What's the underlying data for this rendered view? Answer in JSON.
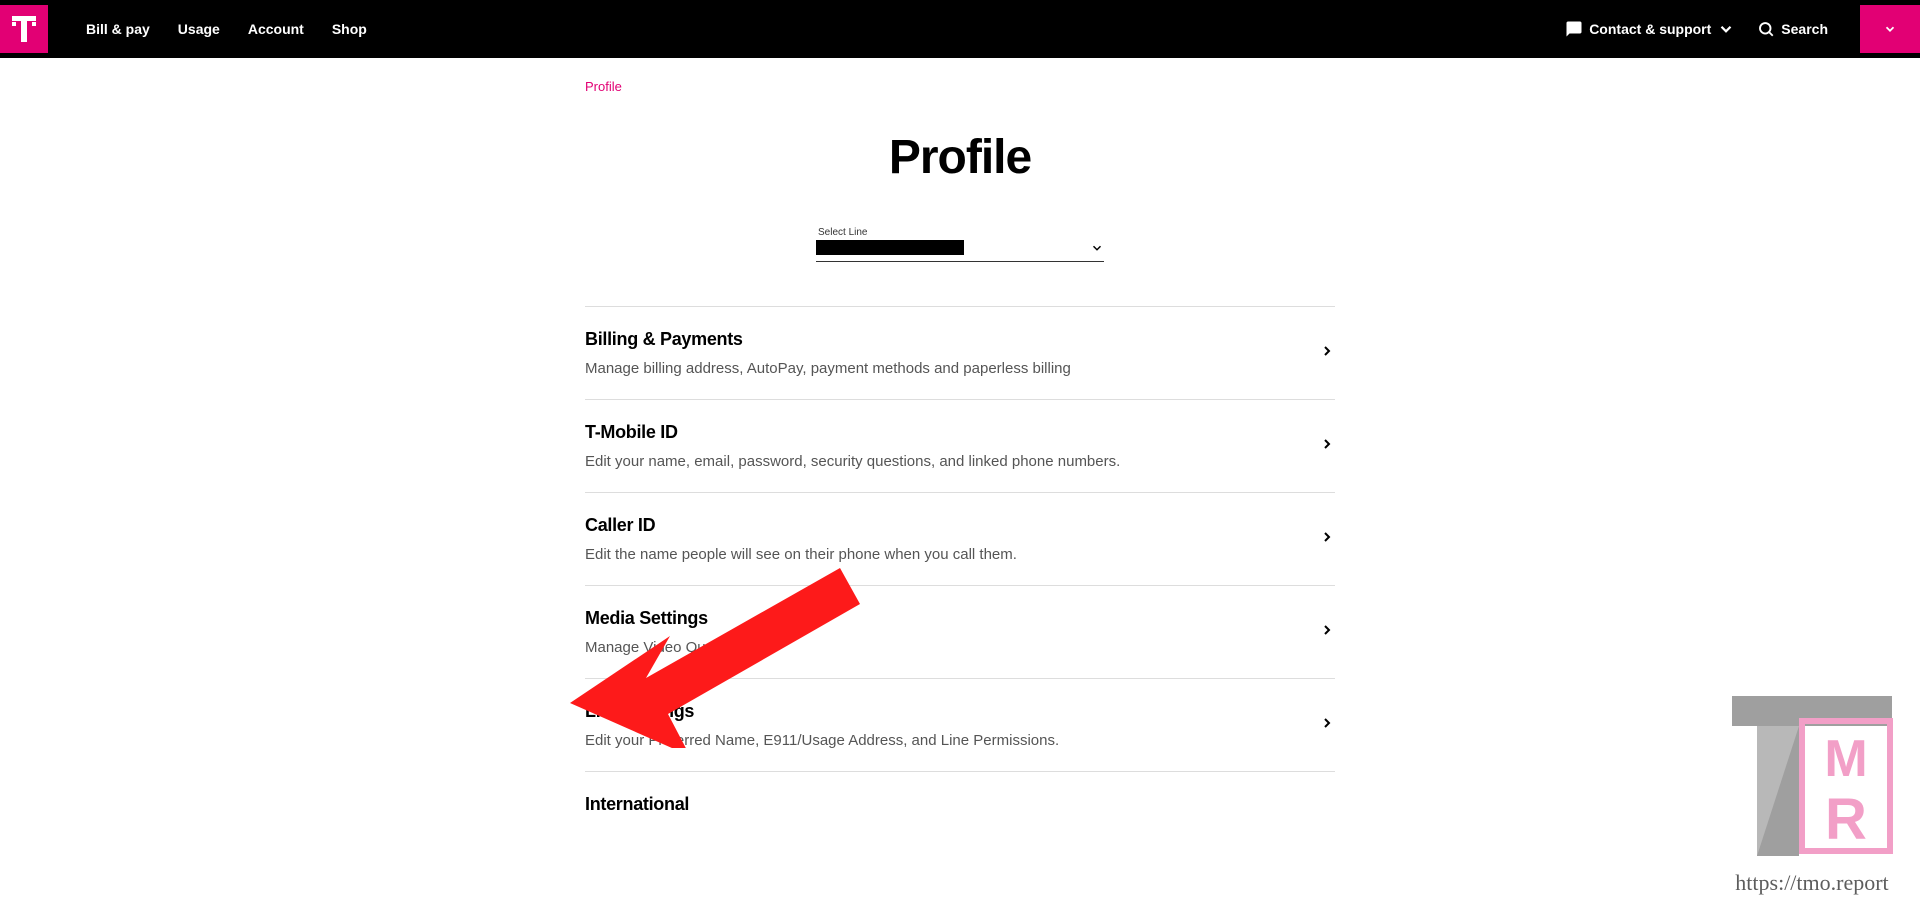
{
  "header": {
    "nav": [
      "Bill & pay",
      "Usage",
      "Account",
      "Shop"
    ],
    "contact_label": "Contact & support",
    "search_label": "Search"
  },
  "breadcrumb": {
    "label": "Profile"
  },
  "page_title": "Profile",
  "select": {
    "label": "Select Line"
  },
  "settings": [
    {
      "title": "Billing & Payments",
      "desc": "Manage billing address, AutoPay, payment methods and paperless billing"
    },
    {
      "title": "T-Mobile ID",
      "desc": "Edit your name, email, password, security questions, and linked phone numbers."
    },
    {
      "title": "Caller ID",
      "desc": "Edit the name people will see on their phone when you call them."
    },
    {
      "title": "Media Settings",
      "desc": "Manage Video Quality"
    },
    {
      "title": "Line Settings",
      "desc": "Edit your Preferred Name, E911/Usage Address, and Line Permissions."
    },
    {
      "title": "International",
      "desc": ""
    }
  ],
  "watermark_url": "https://tmo.report"
}
